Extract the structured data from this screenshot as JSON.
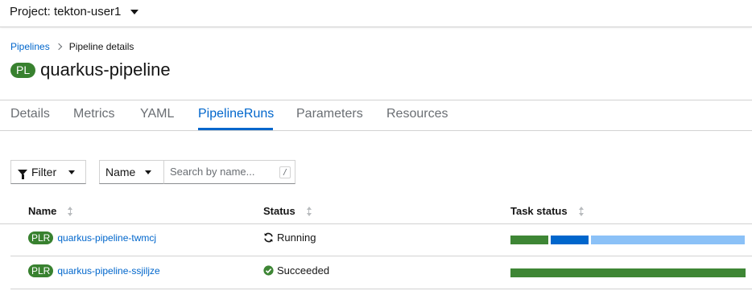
{
  "project": {
    "label": "Project: tekton-user1"
  },
  "breadcrumb": {
    "parent": "Pipelines",
    "current": "Pipeline details"
  },
  "header": {
    "badge": "PL",
    "title": "quarkus-pipeline"
  },
  "tabs": [
    {
      "label": "Details"
    },
    {
      "label": "Metrics"
    },
    {
      "label": "YAML"
    },
    {
      "label": "PipelineRuns",
      "active": true
    },
    {
      "label": "Parameters"
    },
    {
      "label": "Resources"
    }
  ],
  "toolbar": {
    "filter_label": "Filter",
    "name_select": "Name",
    "search_placeholder": "Search by name...",
    "search_value": "",
    "shortcut": "/"
  },
  "table": {
    "columns": [
      "Name",
      "Status",
      "Task status"
    ],
    "rows": [
      {
        "badge": "PLR",
        "name": "quarkus-pipeline-twmcj",
        "status": "Running",
        "status_icon": "sync-icon",
        "task_status": [
          {
            "state": "succeeded",
            "color": "#3e8635",
            "fraction": 0.166
          },
          {
            "state": "running",
            "color": "#0066cc",
            "fraction": 0.166
          },
          {
            "state": "pending",
            "color": "#8bc1f7",
            "fraction": 0.668
          }
        ]
      },
      {
        "badge": "PLR",
        "name": "quarkus-pipeline-ssjiljze",
        "status": "Succeeded",
        "status_icon": "check-circle-icon",
        "task_status": [
          {
            "state": "succeeded",
            "color": "#3e8635",
            "fraction": 1.0
          }
        ]
      }
    ]
  },
  "colors": {
    "link": "#0066cc",
    "badge_green": "#38812f",
    "border": "#d2d2d2"
  }
}
